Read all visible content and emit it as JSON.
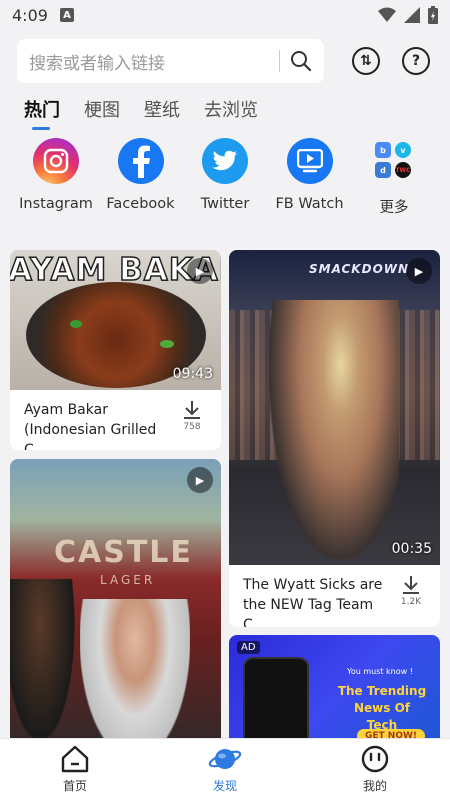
{
  "status": {
    "time": "4:09",
    "notif_badge": "A"
  },
  "search": {
    "placeholder": "搜索或者输入链接"
  },
  "header_icons": {
    "download_symbol": "⇅",
    "help_symbol": "?"
  },
  "tabs": [
    {
      "label": "热门",
      "active": true
    },
    {
      "label": "梗图",
      "active": false
    },
    {
      "label": "壁纸",
      "active": false
    },
    {
      "label": "去浏览",
      "active": false
    }
  ],
  "shortcuts": [
    {
      "label": "Instagram",
      "icon": "instagram-icon"
    },
    {
      "label": "Facebook",
      "icon": "facebook-icon"
    },
    {
      "label": "Twitter",
      "icon": "twitter-icon"
    },
    {
      "label": "FB Watch",
      "icon": "fb-watch-icon"
    },
    {
      "label": "更多",
      "icon": "more-apps-icon"
    }
  ],
  "cards": [
    {
      "title": "Ayam Bakar (Indonesian Grilled C...",
      "duration": "09:43",
      "downloads": "758",
      "banner": "AYAM BAKAR"
    },
    {
      "title": "The Wyatt Sicks are the NEW Tag Team C...",
      "duration": "00:35",
      "downloads": "1.2K",
      "banner": "SMACKDOWN"
    },
    {
      "title": "",
      "banner": "CASTLE",
      "sub_banner": "LAGER"
    },
    {
      "ad_label": "AD",
      "headline": "The Trending News Of Tech",
      "pre_text": "You must know !",
      "cta": "GET NOW!"
    }
  ],
  "bottom_nav": [
    {
      "label": "首页",
      "icon": "home-icon",
      "active": false
    },
    {
      "label": "发现",
      "icon": "planet-icon",
      "active": true
    },
    {
      "label": "我的",
      "icon": "profile-icon",
      "active": false
    }
  ],
  "colors": {
    "accent": "#2f7ae0",
    "background": "#f2f2f4"
  }
}
